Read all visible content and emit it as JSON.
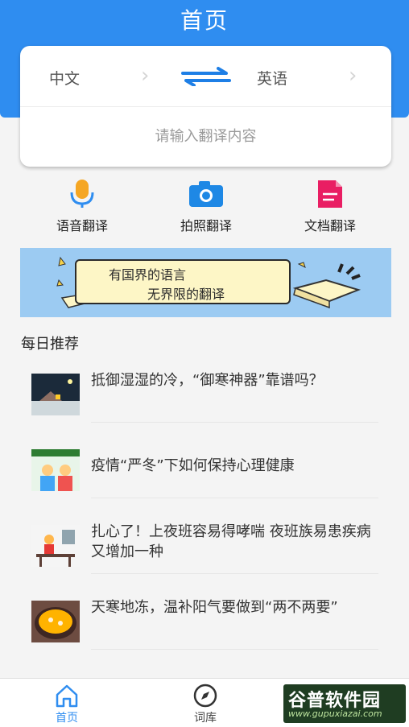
{
  "header": {
    "title": "首页"
  },
  "translator": {
    "source_lang": "中文",
    "target_lang": "英语",
    "input_placeholder": "请输入翻译内容"
  },
  "features": [
    {
      "label": "语音翻译",
      "icon": "microphone-icon"
    },
    {
      "label": "拍照翻译",
      "icon": "camera-icon"
    },
    {
      "label": "文档翻译",
      "icon": "document-icon"
    }
  ],
  "banner": {
    "line1": "有国界的语言",
    "line2": "无界限的翻译"
  },
  "daily": {
    "title": "每日推荐",
    "items": [
      {
        "title": "抵御湿湿的冷，“御寒神器”靠谱吗？"
      },
      {
        "title": "疫情“严冬”下如何保持心理健康"
      },
      {
        "title": "扎心了！上夜班容易得哮喘 夜班族易患疾病又增加一种"
      },
      {
        "title": "天寒地冻，温补阳气要做到“两不两要”"
      }
    ]
  },
  "bottom_nav": {
    "home": "首页",
    "dict": "词库"
  },
  "watermark": {
    "text": "谷普软件园",
    "url": "www.gupuxiazai.com"
  },
  "colors": {
    "accent": "#2f8df0",
    "mic": "#f5a623",
    "camera": "#1e88e5",
    "document": "#e91e63"
  }
}
